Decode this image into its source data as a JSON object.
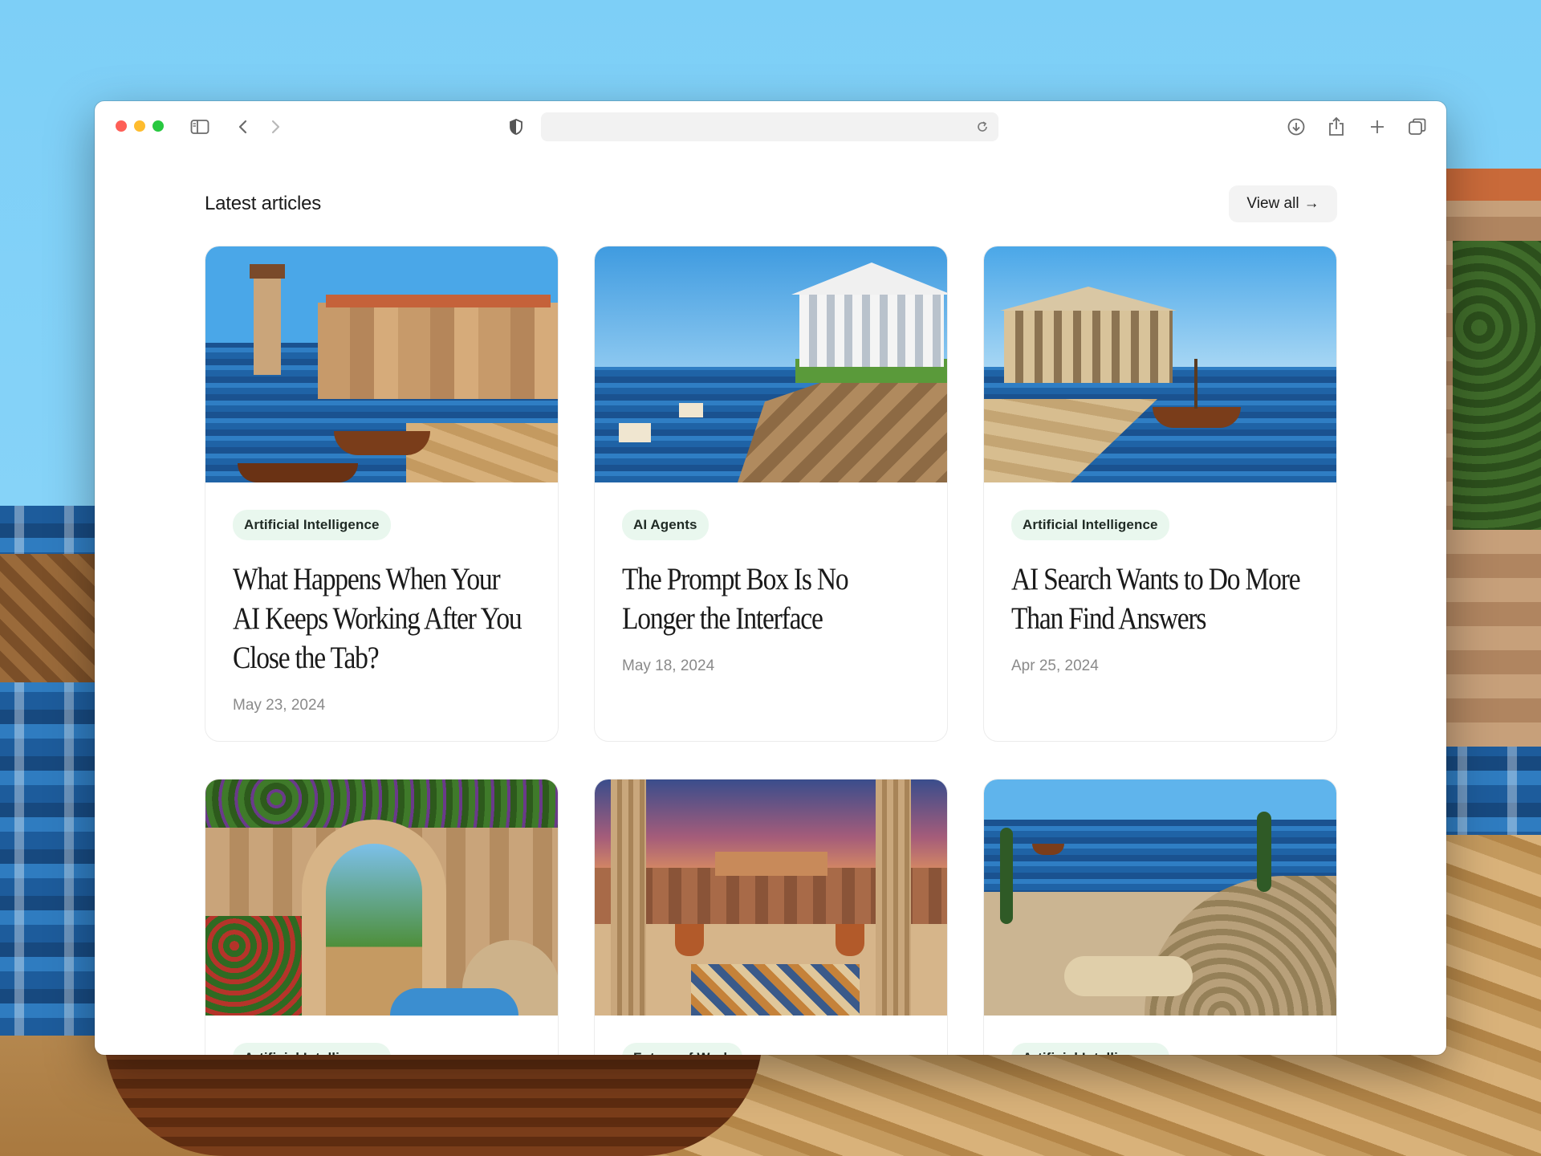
{
  "section": {
    "title": "Latest articles",
    "view_all_label": "View all",
    "view_all_arrow": "→"
  },
  "articles": [
    {
      "tag": "Artificial Intelligence",
      "title": "What Happens When Your AI Keeps Working After You Close the Tab?",
      "date": "May 23, 2024",
      "image": "harbor-lighthouse-boats"
    },
    {
      "tag": "AI Agents",
      "title": "The Prompt Box Is No Longer the Interface",
      "date": "May 18, 2024",
      "image": "temple-on-cliff-sea"
    },
    {
      "tag": "Artificial Intelligence",
      "title": "AI Search Wants to Do More Than Find Answers",
      "date": "Apr 25, 2024",
      "image": "temple-harbor-ship"
    },
    {
      "tag": "Artificial Intelligence",
      "title": "",
      "date": "",
      "image": "garden-archway-fountain"
    },
    {
      "tag": "Future of Work",
      "title": "",
      "date": "",
      "image": "columns-acropolis-sunset"
    },
    {
      "tag": "Artificial Intelligence",
      "title": "",
      "date": "",
      "image": "amphitheater-coast"
    }
  ],
  "icons": {
    "toolbar": [
      "sidebar-icon",
      "back-icon",
      "forward-icon",
      "shield-icon",
      "reload-icon",
      "download-icon",
      "share-icon",
      "new-tab-icon",
      "tabs-overview-icon"
    ]
  },
  "colors": {
    "tag_bg": "#e9f7ee",
    "traffic_red": "#fe5f57",
    "traffic_yellow": "#febc2e",
    "traffic_green": "#28c840"
  }
}
